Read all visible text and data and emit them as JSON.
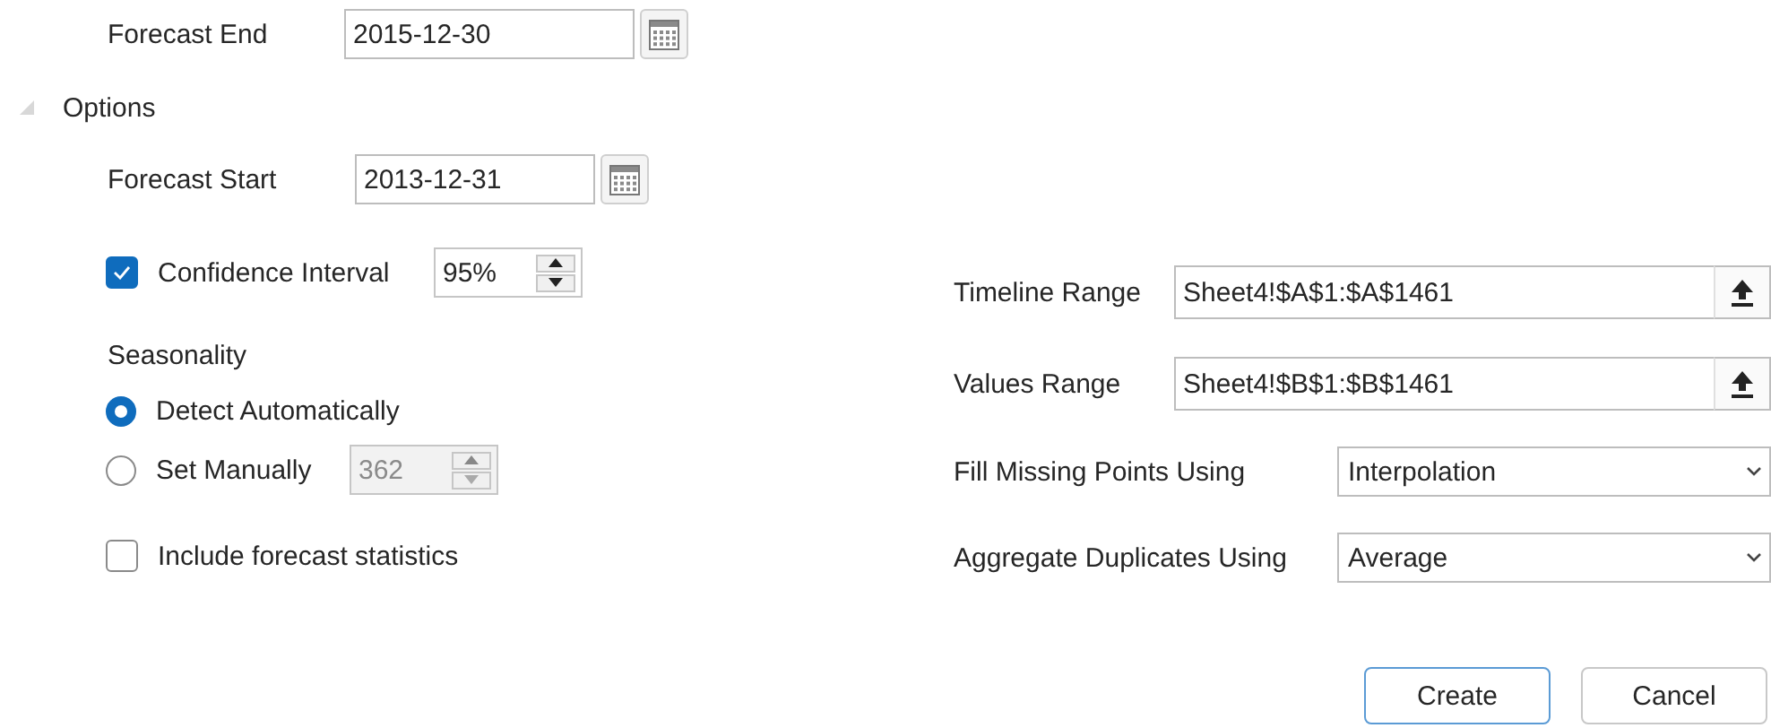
{
  "forecast_end": {
    "label": "Forecast End",
    "value": "2015-12-30"
  },
  "options": {
    "label": "Options",
    "expanded": true,
    "forecast_start": {
      "label": "Forecast Start",
      "value": "2013-12-31"
    },
    "confidence_interval": {
      "label": "Confidence Interval",
      "checked": true,
      "value": "95%"
    },
    "seasonality": {
      "label": "Seasonality",
      "choices": [
        {
          "label": "Detect Automatically",
          "selected": true
        },
        {
          "label": "Set Manually",
          "selected": false,
          "value": "362",
          "disabled": true
        }
      ]
    },
    "include_statistics": {
      "label": "Include forecast statistics",
      "checked": false
    },
    "fields": [
      {
        "kind": "range",
        "label": "Timeline Range",
        "value": "Sheet4!$A$1:$A$1461"
      },
      {
        "kind": "range",
        "label": "Values Range",
        "value": "Sheet4!$B$1:$B$1461"
      },
      {
        "kind": "dropdown",
        "label": "Fill Missing Points Using",
        "value": "Interpolation"
      },
      {
        "kind": "dropdown",
        "label": "Aggregate Duplicates Using",
        "value": "Average"
      }
    ]
  },
  "buttons": [
    {
      "label": "Create",
      "default": true
    },
    {
      "label": "Cancel",
      "default": false
    }
  ]
}
